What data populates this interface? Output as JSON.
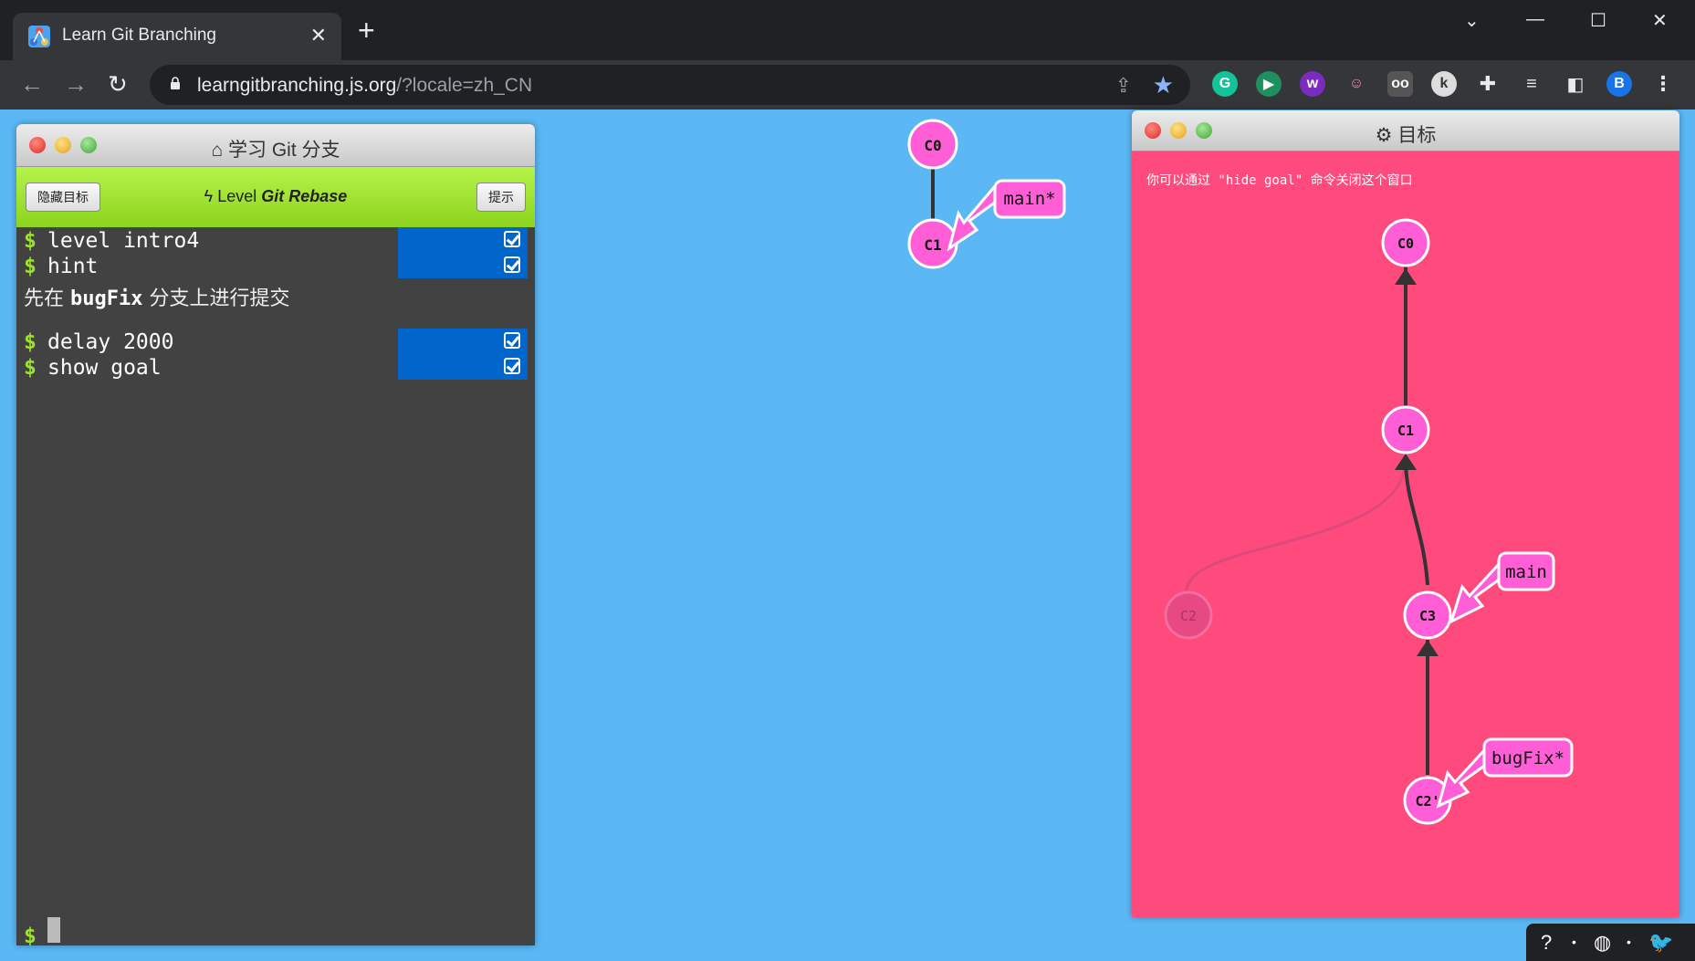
{
  "browser": {
    "tab_title": "Learn Git Branching",
    "tab_close": "✕",
    "new_tab": "+",
    "url_host": "learngitbranching.js.org",
    "url_path": "/?locale=zh_CN",
    "profile_initial": "B",
    "extensions": [
      "grammarly-icon",
      "refresh-ext-icon",
      "w-ext-icon",
      "cat-ext-icon",
      "glasses-ext-icon",
      "k-ext-icon",
      "puzzle-icon",
      "reading-list-icon",
      "side-panel-icon"
    ]
  },
  "terminal": {
    "title": "学习 Git 分支",
    "hide_goal_button": "隐藏目标",
    "hint_button": "提示",
    "level_prefix": "Level",
    "level_name": "Git Rebase",
    "prompt_symbol": "$",
    "commands_a": [
      "level intro4",
      "hint"
    ],
    "hint_prefix": "先在 ",
    "hint_code": "bugFix",
    "hint_suffix": " 分支上进行提交",
    "commands_b": [
      "delay 2000",
      "show goal"
    ]
  },
  "main_tree": {
    "commits": [
      "C0",
      "C1"
    ],
    "branch_label": "main*"
  },
  "goal": {
    "title": "目标",
    "hint": "你可以通过 \"hide goal\" 命令关闭这个窗口",
    "commits": [
      "C0",
      "C1",
      "C2",
      "C3",
      "C2'"
    ],
    "branches": [
      "main",
      "bugFix*"
    ]
  },
  "colors": {
    "commit_fill": "#ff5ed6",
    "goal_background": "#ff4a7d",
    "canvas_background": "#5cb8f5",
    "level_bar": "#8cd41e",
    "command_done": "#0066cc"
  }
}
